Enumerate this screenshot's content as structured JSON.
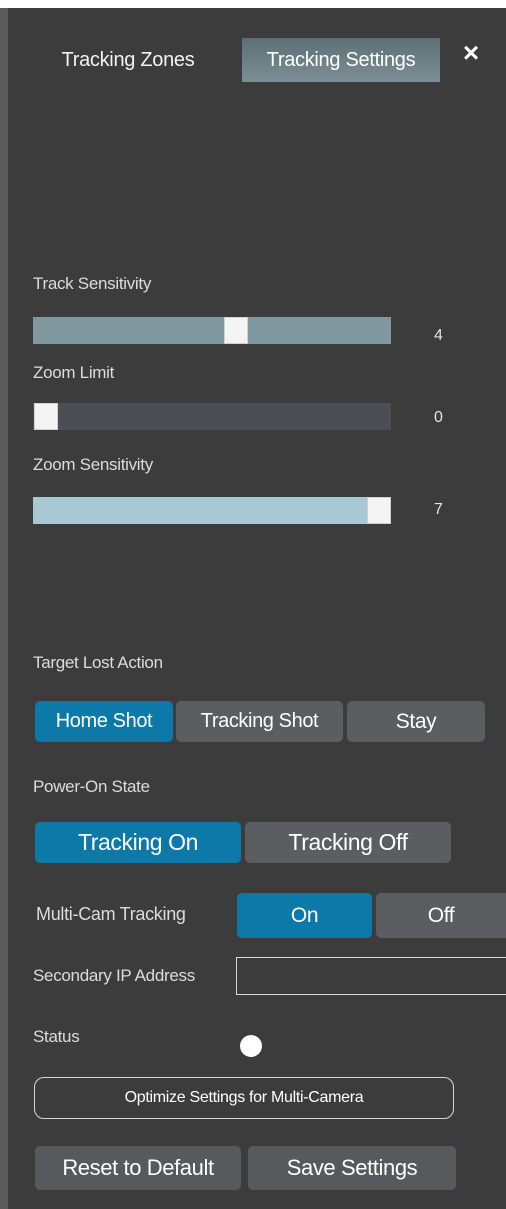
{
  "tabs": {
    "zones": "Tracking Zones",
    "settings": "Tracking Settings"
  },
  "close_icon": "×",
  "sliders": {
    "track_sensitivity": {
      "label": "Track Sensitivity",
      "value": "4"
    },
    "zoom_limit": {
      "label": "Zoom Limit",
      "value": "0"
    },
    "zoom_sensitivity": {
      "label": "Zoom Sensitivity",
      "value": "7"
    }
  },
  "target_lost": {
    "label": "Target Lost Action",
    "options": [
      "Home Shot",
      "Tracking Shot",
      "Stay"
    ],
    "selected": "Home Shot"
  },
  "power_on": {
    "label": "Power-On State",
    "options": [
      "Tracking On",
      "Tracking Off"
    ],
    "selected": "Tracking On"
  },
  "multi_cam": {
    "label": "Multi-Cam Tracking",
    "options": [
      "On",
      "Off"
    ],
    "selected": "On"
  },
  "secondary_ip": {
    "label": "Secondary IP Address",
    "value": ""
  },
  "status": {
    "label": "Status"
  },
  "buttons": {
    "optimize": "Optimize Settings for Multi-Camera",
    "reset": "Reset to Default",
    "save": "Save Settings"
  },
  "colors": {
    "panel_bg": "#3c3c3c",
    "accent_selected": "#0d79a8",
    "unselected": "#5b5d61",
    "slider_fill": "#7e989e",
    "slider_fill_light": "#a8c8d4"
  },
  "icons": {
    "close": "close-icon",
    "status": "status-indicator"
  }
}
